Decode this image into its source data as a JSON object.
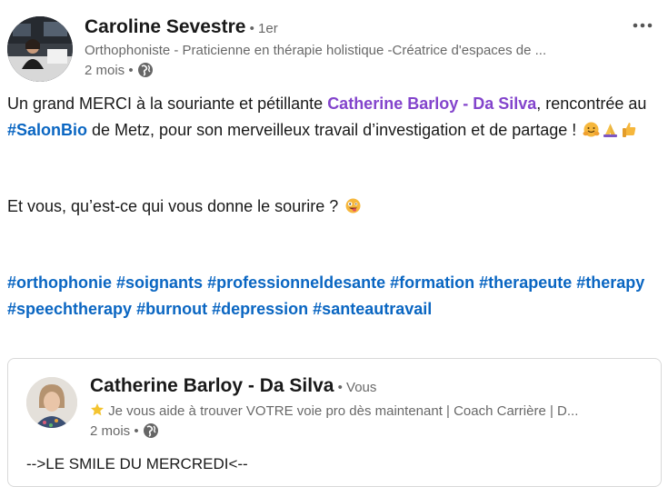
{
  "post": {
    "author": {
      "name": "Caroline Sevestre",
      "degree": " • 1er",
      "headline": "Orthophoniste - Praticienne en thérapie holistique -Créatrice d'espaces de ...",
      "time": "2 mois •"
    },
    "more_icon": "more-horizontal-icon",
    "body": {
      "p1_before": "Un grand MERCI à la souriante et pétillante ",
      "mention": "Catherine Barloy - Da Silva",
      "p1_mid": ", rencontrée au ",
      "hashtag_inline": "#SalonBio",
      "p1_after": " de Metz, pour son merveilleux travail d’investigation et de partage ! ",
      "p2": "Et vous, qu’est-ce qui vous donne le sourire ? ",
      "hashtags": [
        "#orthophonie",
        "#soignants",
        "#professionneldesante",
        "#formation",
        "#therapeute",
        "#therapy",
        "#speechtherapy",
        "#burnout",
        "#depression",
        "#santeautravail"
      ]
    },
    "shared": {
      "name": "Catherine Barloy - Da Silva",
      "degree": " • Vous",
      "headline": " Je vous aide à trouver VOTRE voie pro dès maintenant | Coach Carrière | D...",
      "time": "2 mois •",
      "text": "-->LE SMILE DU MERCREDI<--"
    }
  },
  "colors": {
    "mention": "#8344cc",
    "hashtag": "#0a66c2"
  }
}
